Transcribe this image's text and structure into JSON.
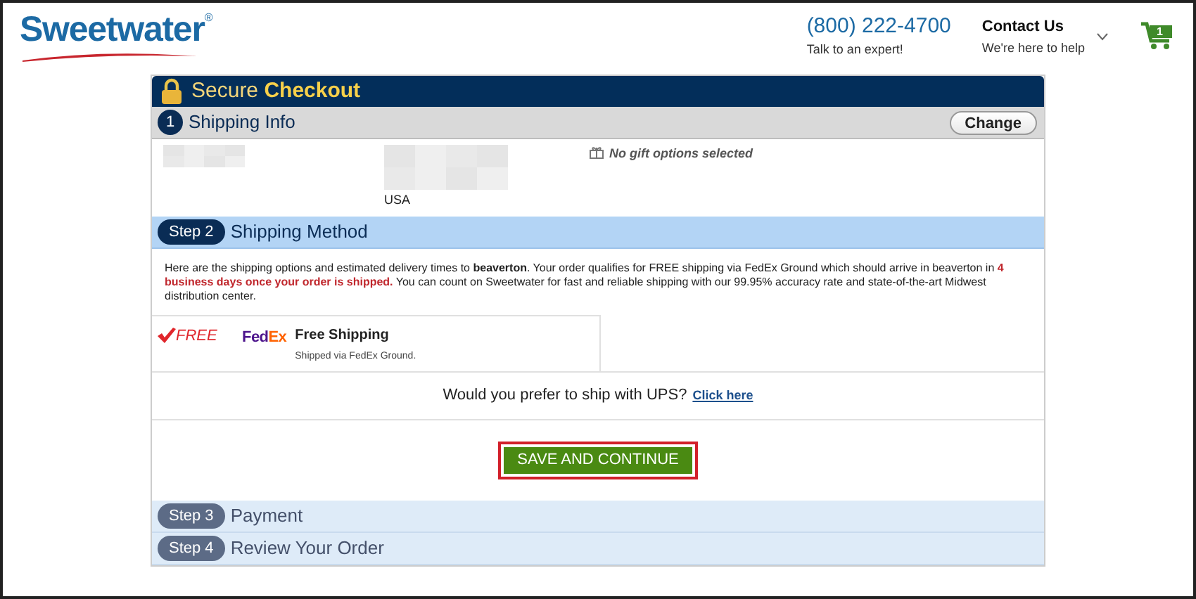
{
  "header": {
    "logo": "Sweetwater",
    "logo_mark": "®",
    "phone": "(800) 222-4700",
    "phone_caption": "Talk to an expert!",
    "contact_title": "Contact Us",
    "contact_caption": "We're here to help",
    "cart_count": "1"
  },
  "checkout": {
    "title_light": "Secure",
    "title_bold": "Checkout"
  },
  "steps": [
    {
      "kind": "done",
      "badge": "1",
      "label": "Shipping Info",
      "action": "Change"
    },
    {
      "kind": "active",
      "badge": "Step 2",
      "label": "Shipping Method"
    },
    {
      "kind": "pending",
      "badge": "Step 3",
      "label": "Payment"
    },
    {
      "kind": "pending",
      "badge": "Step 4",
      "label": "Review Your Order"
    }
  ],
  "shipping_info": {
    "country": "USA",
    "gift_note": "No gift options selected"
  },
  "shipping_method": {
    "intro_before": "Here are the shipping options and estimated delivery times to **beaverton**. Your order qualifies for FREE shipping via FedEx Ground which should arrive in beaverton in",
    "intro_highlight": "4 business days once your order is shipped.",
    "intro_after": "You can count on Sweetwater for fast and reliable shipping with our 99.95% accuracy rate and state-of-the-art Midwest distribution center.",
    "option": {
      "price": "FREE",
      "carrier_first": "Fed",
      "carrier_second": "Ex",
      "name": "Free Shipping",
      "detail": "Shipped via FedEx Ground.",
      "selected": true
    },
    "ups_question": "Would you prefer to ship with UPS?",
    "ups_link": "Click here",
    "submit": "SAVE AND CONTINUE"
  }
}
